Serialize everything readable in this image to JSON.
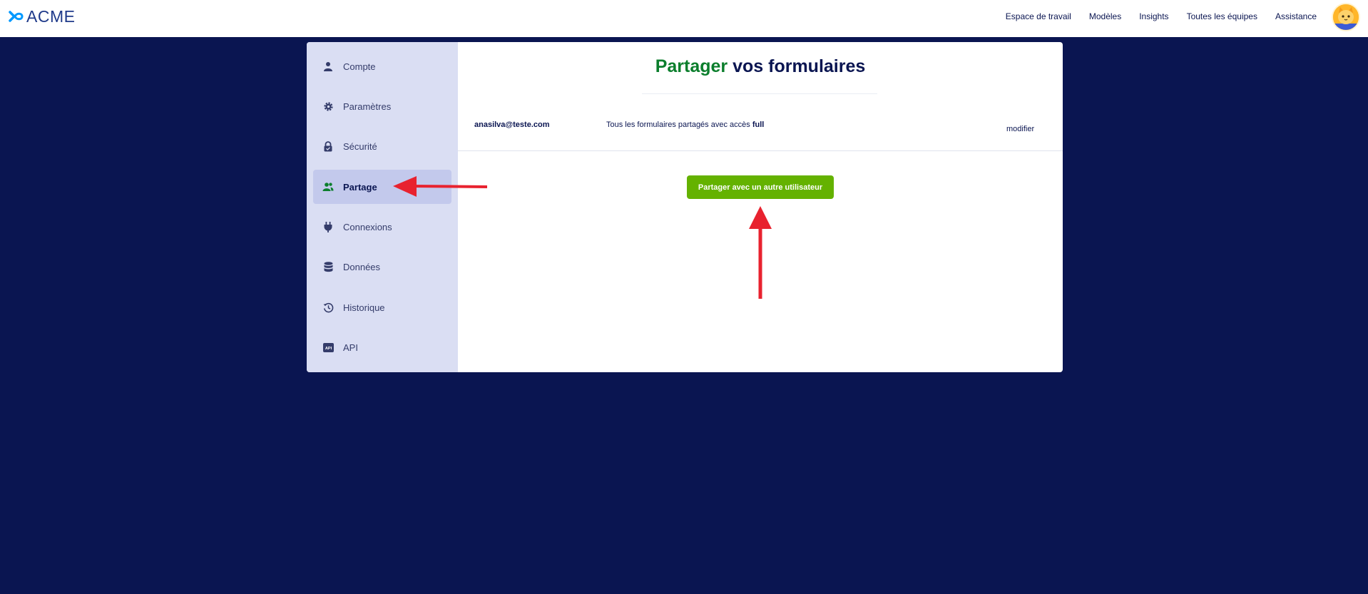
{
  "brand": {
    "name": "ACME",
    "accent": "#0099ff",
    "text_color": "#1f3a8a"
  },
  "nav": {
    "items": [
      "Espace de travail",
      "Modèles",
      "Insights",
      "Toutes les équipes",
      "Assistance"
    ]
  },
  "avatar": {
    "icon": "cat-avatar-icon"
  },
  "sidebar": {
    "items": [
      {
        "label": "Compte",
        "icon": "user-icon"
      },
      {
        "label": "Paramètres",
        "icon": "gear-icon"
      },
      {
        "label": "Sécurité",
        "icon": "lock-icon"
      },
      {
        "label": "Partage",
        "icon": "users-icon",
        "active": true
      },
      {
        "label": "Connexions",
        "icon": "plug-icon"
      },
      {
        "label": "Données",
        "icon": "database-icon"
      },
      {
        "label": "Historique",
        "icon": "history-icon"
      },
      {
        "label": "API",
        "icon": "api-icon"
      }
    ]
  },
  "main": {
    "title_highlight": "Partager",
    "title_rest": " vos formulaires",
    "share_row": {
      "email": "anasilva@teste.com",
      "description": "Tous les formulaires partagés avec accès ",
      "access": "full",
      "edit_label": "modifier"
    },
    "share_button_label": "Partager avec un autre utilisateur"
  },
  "colors": {
    "page_background": "#0a1551",
    "title_green": "#0b7e2c",
    "button_green": "#64b200",
    "sidebar_bg": "#dadef3",
    "sidebar_active": "#c3c9ec",
    "annotation_red": "#e8222f"
  }
}
